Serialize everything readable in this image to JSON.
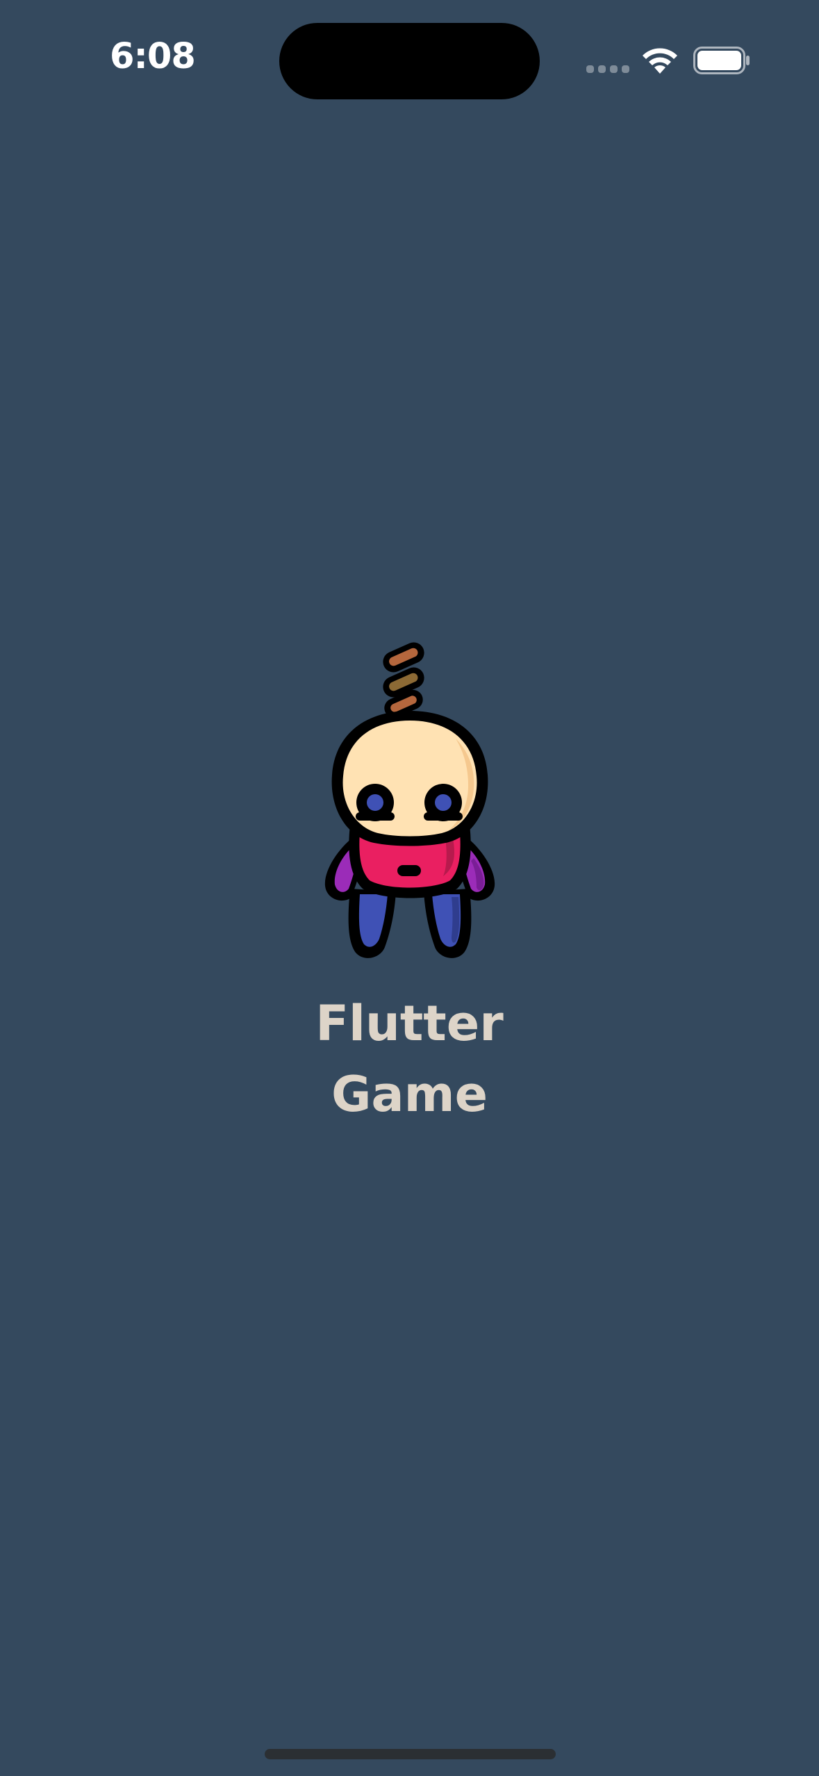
{
  "status_bar": {
    "time": "6:08",
    "wifi_icon": "wifi-icon",
    "battery_icon": "battery-icon",
    "signal_icon": "cellular-signal-icon"
  },
  "splash": {
    "title_line1": "Flutter",
    "title_line2": "Game",
    "mascot_icon": "hanging-doll-icon"
  },
  "colors": {
    "background": "#34495e",
    "title": "#ddd4c8",
    "skin": "#ffe2b3",
    "shirt": "#ea1f61",
    "arms": "#9b2cb8",
    "legs": "#3f51b5",
    "rope": "#b5673d"
  }
}
